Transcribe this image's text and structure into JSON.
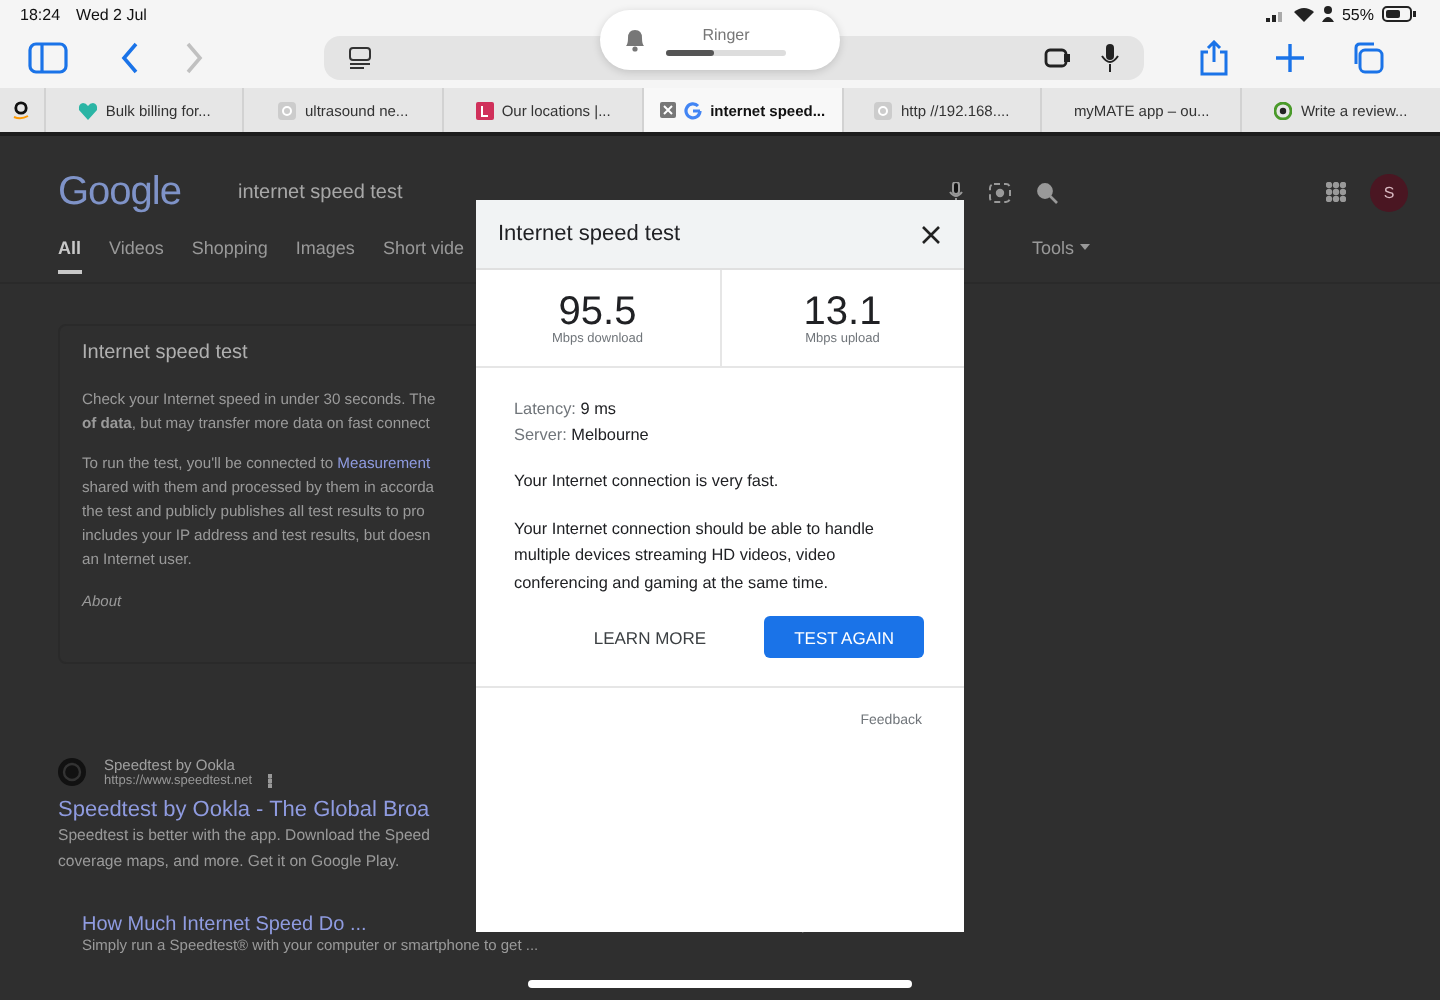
{
  "status_bar": {
    "time": "18:24",
    "date": "Wed 2 Jul",
    "battery": "55%"
  },
  "ringer": {
    "label": "Ringer",
    "level": 0.4
  },
  "toolbar": {
    "forward_disabled": true
  },
  "tabs": [
    {
      "selected": false
    },
    {
      "label": "Bulk billing for...",
      "selected": false
    },
    {
      "label": "ultrasound ne...",
      "selected": false
    },
    {
      "label": "Our locations |...",
      "selected": false
    },
    {
      "label": "internet speed...",
      "selected": true
    },
    {
      "label": "http //192.168....",
      "selected": false
    },
    {
      "label": "myMATE app – ou...",
      "selected": false
    },
    {
      "label": "Write a review...",
      "selected": false
    }
  ],
  "page": {
    "logo": "Google",
    "query": "internet speed test",
    "avatar": "S",
    "search_tabs": [
      {
        "label": "All",
        "selected": true
      },
      {
        "label": "Videos",
        "selected": false
      },
      {
        "label": "Shopping",
        "selected": false
      },
      {
        "label": "Images",
        "selected": false
      },
      {
        "label": "Short vide",
        "selected": false
      }
    ],
    "tools": "Tools",
    "card": {
      "title": "Internet speed test",
      "paragraphs": [
        [
          {
            "text": "Check your Internet speed in under 30 seconds. The"
          },
          {
            "text": "**of data**, but may transfer more data on fast connect"
          }
        ],
        [
          {
            "text": "To run the test, you'll be connected to ",
            "link": "Measurement"
          },
          {
            "text": "shared with them and processed by them in accorda"
          },
          {
            "text": "the test and publicly publishes all test results to pro"
          },
          {
            "text": "includes your IP address and test results, but doesn"
          },
          {
            "text": "an Internet user."
          }
        ]
      ],
      "footer": "About"
    },
    "result": {
      "site": "Speedtest by Ookla",
      "url": "https://www.speedtest.net",
      "title": "Speedtest by Ookla - The Global Broa",
      "snippet": [
        "Speedtest is better with the app. Download the Speed",
        "coverage maps, and more. Get it on Google Play."
      ],
      "sublink": "How Much Internet Speed Do ...",
      "subsnippet": "Simply run a Speedtest® with your computer or smartphone to get ..."
    }
  },
  "dialog": {
    "title": "Internet speed test",
    "stats": [
      {
        "value": "95.5",
        "unit": "Mbps download"
      },
      {
        "value": "13.1",
        "unit": "Mbps upload"
      }
    ],
    "details": [
      {
        "label": "Latency: ",
        "value": "9 ms"
      },
      {
        "label": "Server: ",
        "value": "Melbourne"
      }
    ],
    "verdict": "Your Internet connection is very fast.",
    "description": "Your Internet connection should be able to handle multiple devices streaming HD videos, video conferencing and gaming at the same time.",
    "buttons": [
      {
        "label": "LEARN MORE",
        "kind": "text"
      },
      {
        "label": "TEST AGAIN",
        "kind": "primary"
      }
    ],
    "feedback": "Feedback"
  }
}
